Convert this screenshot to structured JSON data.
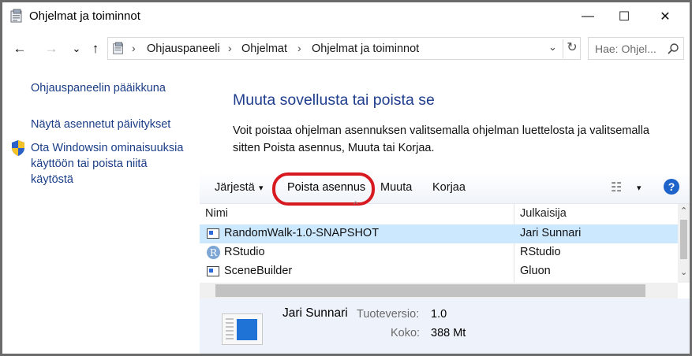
{
  "window": {
    "title": "Ohjelmat ja toiminnot",
    "minimize": "—",
    "maximize": "☐",
    "close": "✕"
  },
  "nav": {
    "back": "←",
    "forward": "→",
    "recent": "⌄",
    "up": "↑",
    "breadcrumb": [
      "Ohjauspaneeli",
      "Ohjelmat",
      "Ohjelmat ja toiminnot"
    ],
    "separator": "›",
    "dropdown": "⌄",
    "refresh": "↻",
    "search_placeholder": "Hae: Ohjel...",
    "search_icon": "search-icon"
  },
  "sidebar": {
    "links": [
      "Ohjauspaneelin pääikkuna",
      "Näytä asennetut päivitykset",
      "Ota Windowsin ominaisuuksia käyttöön tai poista niitä käytöstä"
    ]
  },
  "main": {
    "heading": "Muuta sovellusta tai poista se",
    "description": "Voit poistaa ohjelman asennuksen valitsemalla ohjelman luettelosta ja valitsemalla sitten Poista asennus, Muuta tai Korjaa."
  },
  "toolbar": {
    "organize": "Järjestä",
    "organize_arrow": "▾",
    "uninstall": "Poista asennus",
    "change": "Muuta",
    "repair": "Korjaa",
    "view_icon": "☷",
    "view_arrow": "▾",
    "help": "?"
  },
  "list": {
    "columns": [
      "Nimi",
      "Julkaisija"
    ],
    "sort_indicator": "^",
    "rows": [
      {
        "name": "RandomWalk-1.0-SNAPSHOT",
        "publisher": "Jari Sunnari",
        "icon": "app-window-icon",
        "selected": true
      },
      {
        "name": "RStudio",
        "publisher": "RStudio",
        "icon": "r-icon",
        "icon_letter": "R",
        "selected": false
      },
      {
        "name": "SceneBuilder",
        "publisher": "Gluon",
        "icon": "app-window-icon",
        "selected": false
      }
    ],
    "scroll_up": "⌃",
    "scroll_down": "⌄"
  },
  "details": {
    "publisher": "Jari Sunnari",
    "version_label": "Tuoteversio:",
    "version": "1.0",
    "size_label": "Koko:",
    "size": "388 Mt"
  },
  "colors": {
    "accent_blue": "#1e3d8c",
    "link_blue": "#1a3d86",
    "selection": "#cce8ff",
    "highlight_oval": "#d71920",
    "details_bg": "#eef3fb"
  }
}
